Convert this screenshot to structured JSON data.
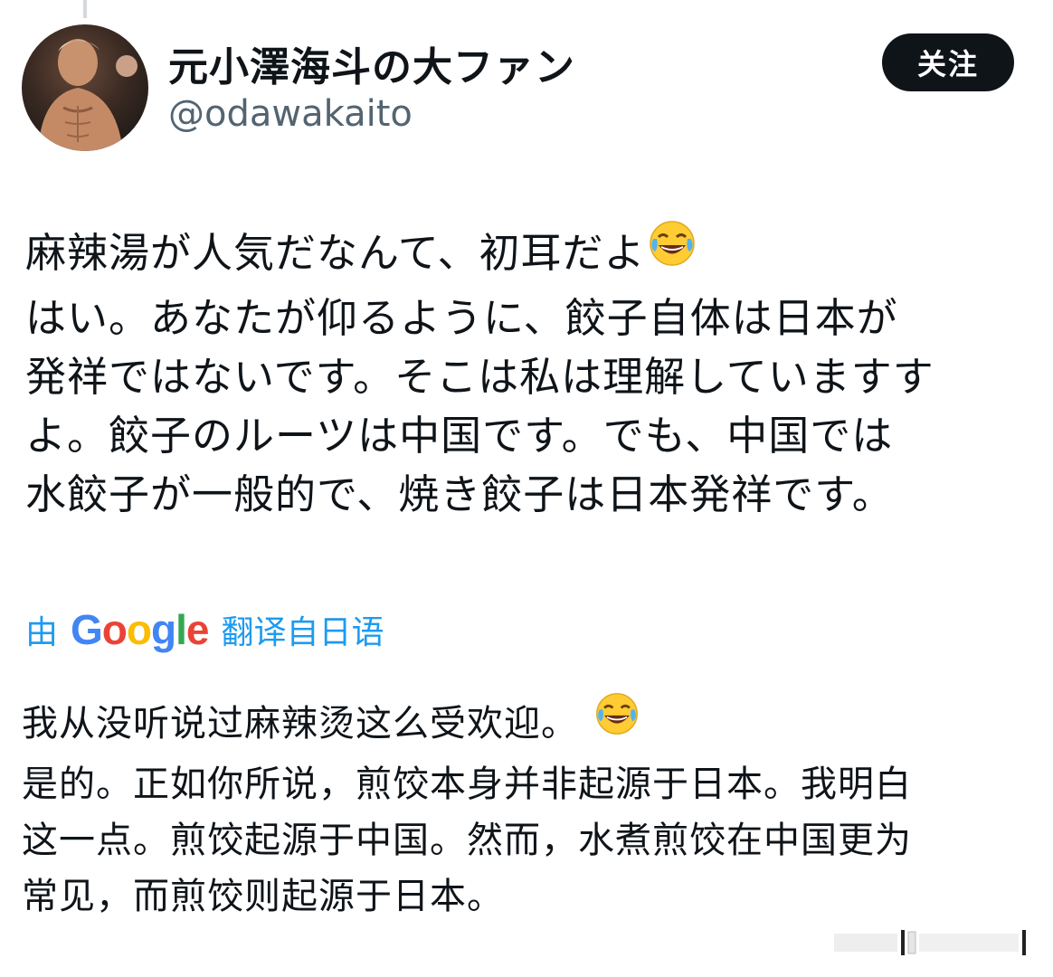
{
  "author": {
    "display_name": "元小澤海斗の大ファン",
    "handle": "@odawakaito",
    "avatar_icon": "profile-photo"
  },
  "follow_button": {
    "label": "关注"
  },
  "post": {
    "original_lines": [
      "麻辣湯が人気だなんて、初耳だよ",
      "はい。あなたが仰るように、餃子自体は日本が",
      "発祥ではないです。そこは私は理解していますす",
      "よ。餃子のルーツは中国です。でも、中国では",
      "水餃子が一般的で、焼き餃子は日本発祥です。"
    ],
    "original_emoji": "tears-of-joy-emoji",
    "translation_label": {
      "prefix": "由",
      "brand": "Google",
      "suffix": "翻译自日语"
    },
    "translated_lines": [
      "我从没听说过麻辣烫这么受欢迎。",
      "是的。正如你所说，煎饺本身并非起源于日本。我明白",
      "这一点。煎饺起源于中国。然而，水煮煎饺在中国更为",
      "常见，而煎饺则起源于日本。"
    ],
    "translated_emoji": "tears-of-joy-emoji"
  },
  "colors": {
    "accent": "#1d9bf0",
    "text": "#0f1419",
    "secondary_text": "#536471",
    "button_bg": "#0f1419"
  }
}
